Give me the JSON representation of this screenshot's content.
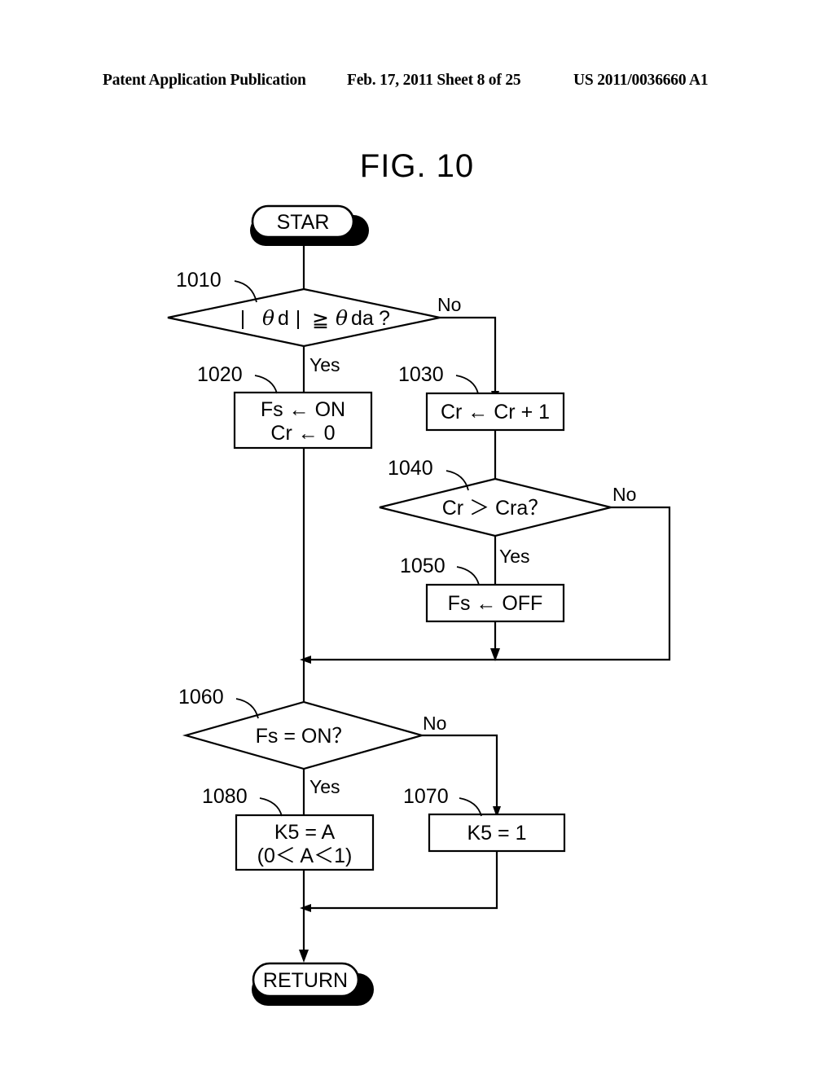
{
  "header": {
    "left": "Patent Application Publication",
    "center": "Feb. 17, 2011  Sheet 8 of 25",
    "right": "US 2011/0036660 A1"
  },
  "figure": {
    "title": "FIG. 10",
    "type": "flowchart"
  },
  "nodes": {
    "start": {
      "label": "STAR",
      "shape": "terminator"
    },
    "end": {
      "label": "RETURN",
      "shape": "terminator"
    },
    "d1010": {
      "ref": "1010",
      "shape": "decision",
      "text_a": "|",
      "theta1": "θ",
      "sub1": "d",
      "text_b": "|",
      "op": "≧",
      "theta2": "θ",
      "sub2": "da",
      "text_c": "?"
    },
    "p1020": {
      "ref": "1020",
      "shape": "process",
      "line1": "Fs ← ON",
      "line2": "Cr ← 0"
    },
    "p1030": {
      "ref": "1030",
      "shape": "process",
      "line1": "Cr ← Cr + 1"
    },
    "d1040": {
      "ref": "1040",
      "shape": "decision",
      "line1": "Cr ＞ Cra？"
    },
    "p1050": {
      "ref": "1050",
      "shape": "process",
      "line1": "Fs ← OFF"
    },
    "d1060": {
      "ref": "1060",
      "shape": "decision",
      "line1": "Fs = ON？"
    },
    "p1070": {
      "ref": "1070",
      "shape": "process",
      "line1": "K5 = 1"
    },
    "p1080": {
      "ref": "1080",
      "shape": "process",
      "line1": "K5 = A",
      "line2": "(0＜ A＜1)"
    }
  },
  "branch_labels": {
    "no_1010": "No",
    "yes_1010": "Yes",
    "no_1040": "No",
    "yes_1040": "Yes",
    "no_1060": "No",
    "yes_1060": "Yes"
  },
  "chart_data": {
    "type": "flowchart",
    "title": "FIG. 10",
    "steps": [
      {
        "id": "start",
        "ref": "",
        "type": "terminator",
        "text": "STAR"
      },
      {
        "id": "1010",
        "ref": "1010",
        "type": "decision",
        "text": "|θd| ≧ θda?",
        "yes": "1020",
        "no": "1030"
      },
      {
        "id": "1020",
        "ref": "1020",
        "type": "process",
        "text": "Fs ← ON ; Cr ← 0",
        "next": "1060"
      },
      {
        "id": "1030",
        "ref": "1030",
        "type": "process",
        "text": "Cr ← Cr + 1",
        "next": "1040"
      },
      {
        "id": "1040",
        "ref": "1040",
        "type": "decision",
        "text": "Cr ＞ Cra？",
        "yes": "1050",
        "no": "1060"
      },
      {
        "id": "1050",
        "ref": "1050",
        "type": "process",
        "text": "Fs ← OFF",
        "next": "1060"
      },
      {
        "id": "1060",
        "ref": "1060",
        "type": "decision",
        "text": "Fs = ON？",
        "yes": "1080",
        "no": "1070"
      },
      {
        "id": "1070",
        "ref": "1070",
        "type": "process",
        "text": "K5 = 1",
        "next": "return"
      },
      {
        "id": "1080",
        "ref": "1080",
        "type": "process",
        "text": "K5 = A (0＜ A＜1)",
        "next": "return"
      },
      {
        "id": "return",
        "ref": "",
        "type": "terminator",
        "text": "RETURN"
      }
    ]
  }
}
